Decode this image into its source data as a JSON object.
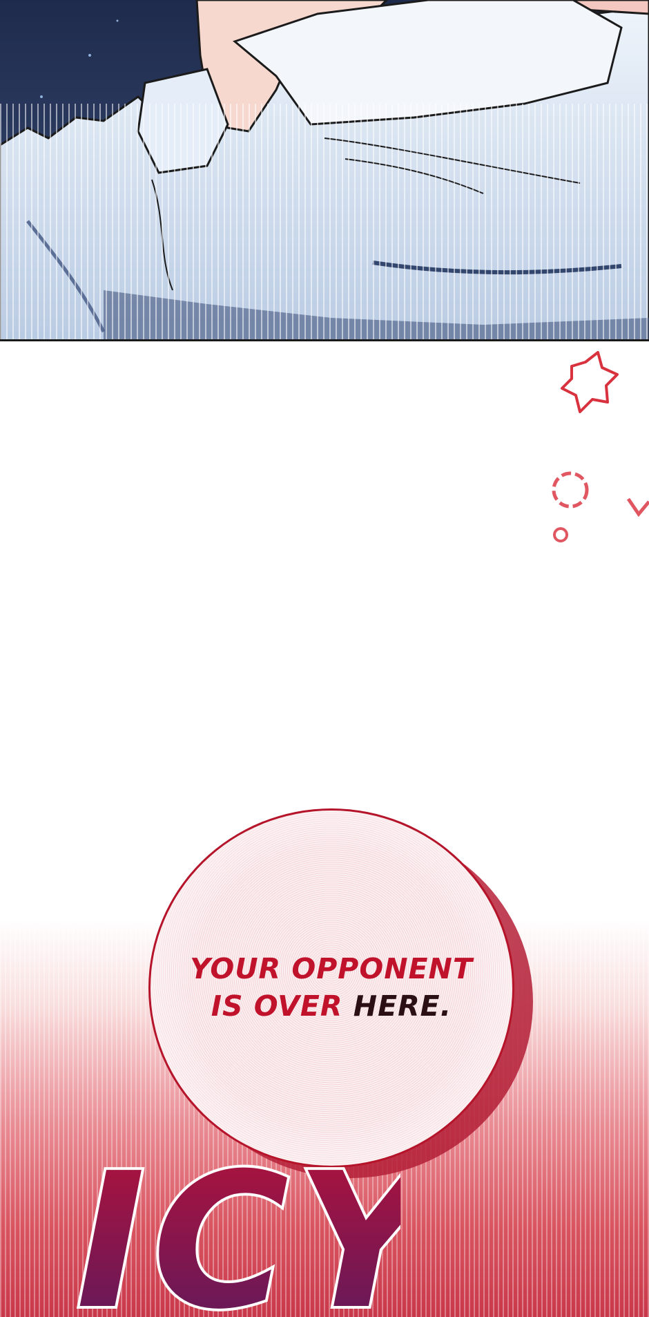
{
  "panels": {
    "bubble": {
      "line1": "YOUR OPPONENT",
      "line2_a": "IS OVER ",
      "line2_b": "HERE."
    },
    "sfx": {
      "text": "ICY"
    }
  },
  "colors": {
    "sfx_fill_top": "#b3123a",
    "sfx_fill_bottom": "#5a1a5e",
    "bubble_border": "#b5142a",
    "panel_bg": "#2b3a5e"
  }
}
